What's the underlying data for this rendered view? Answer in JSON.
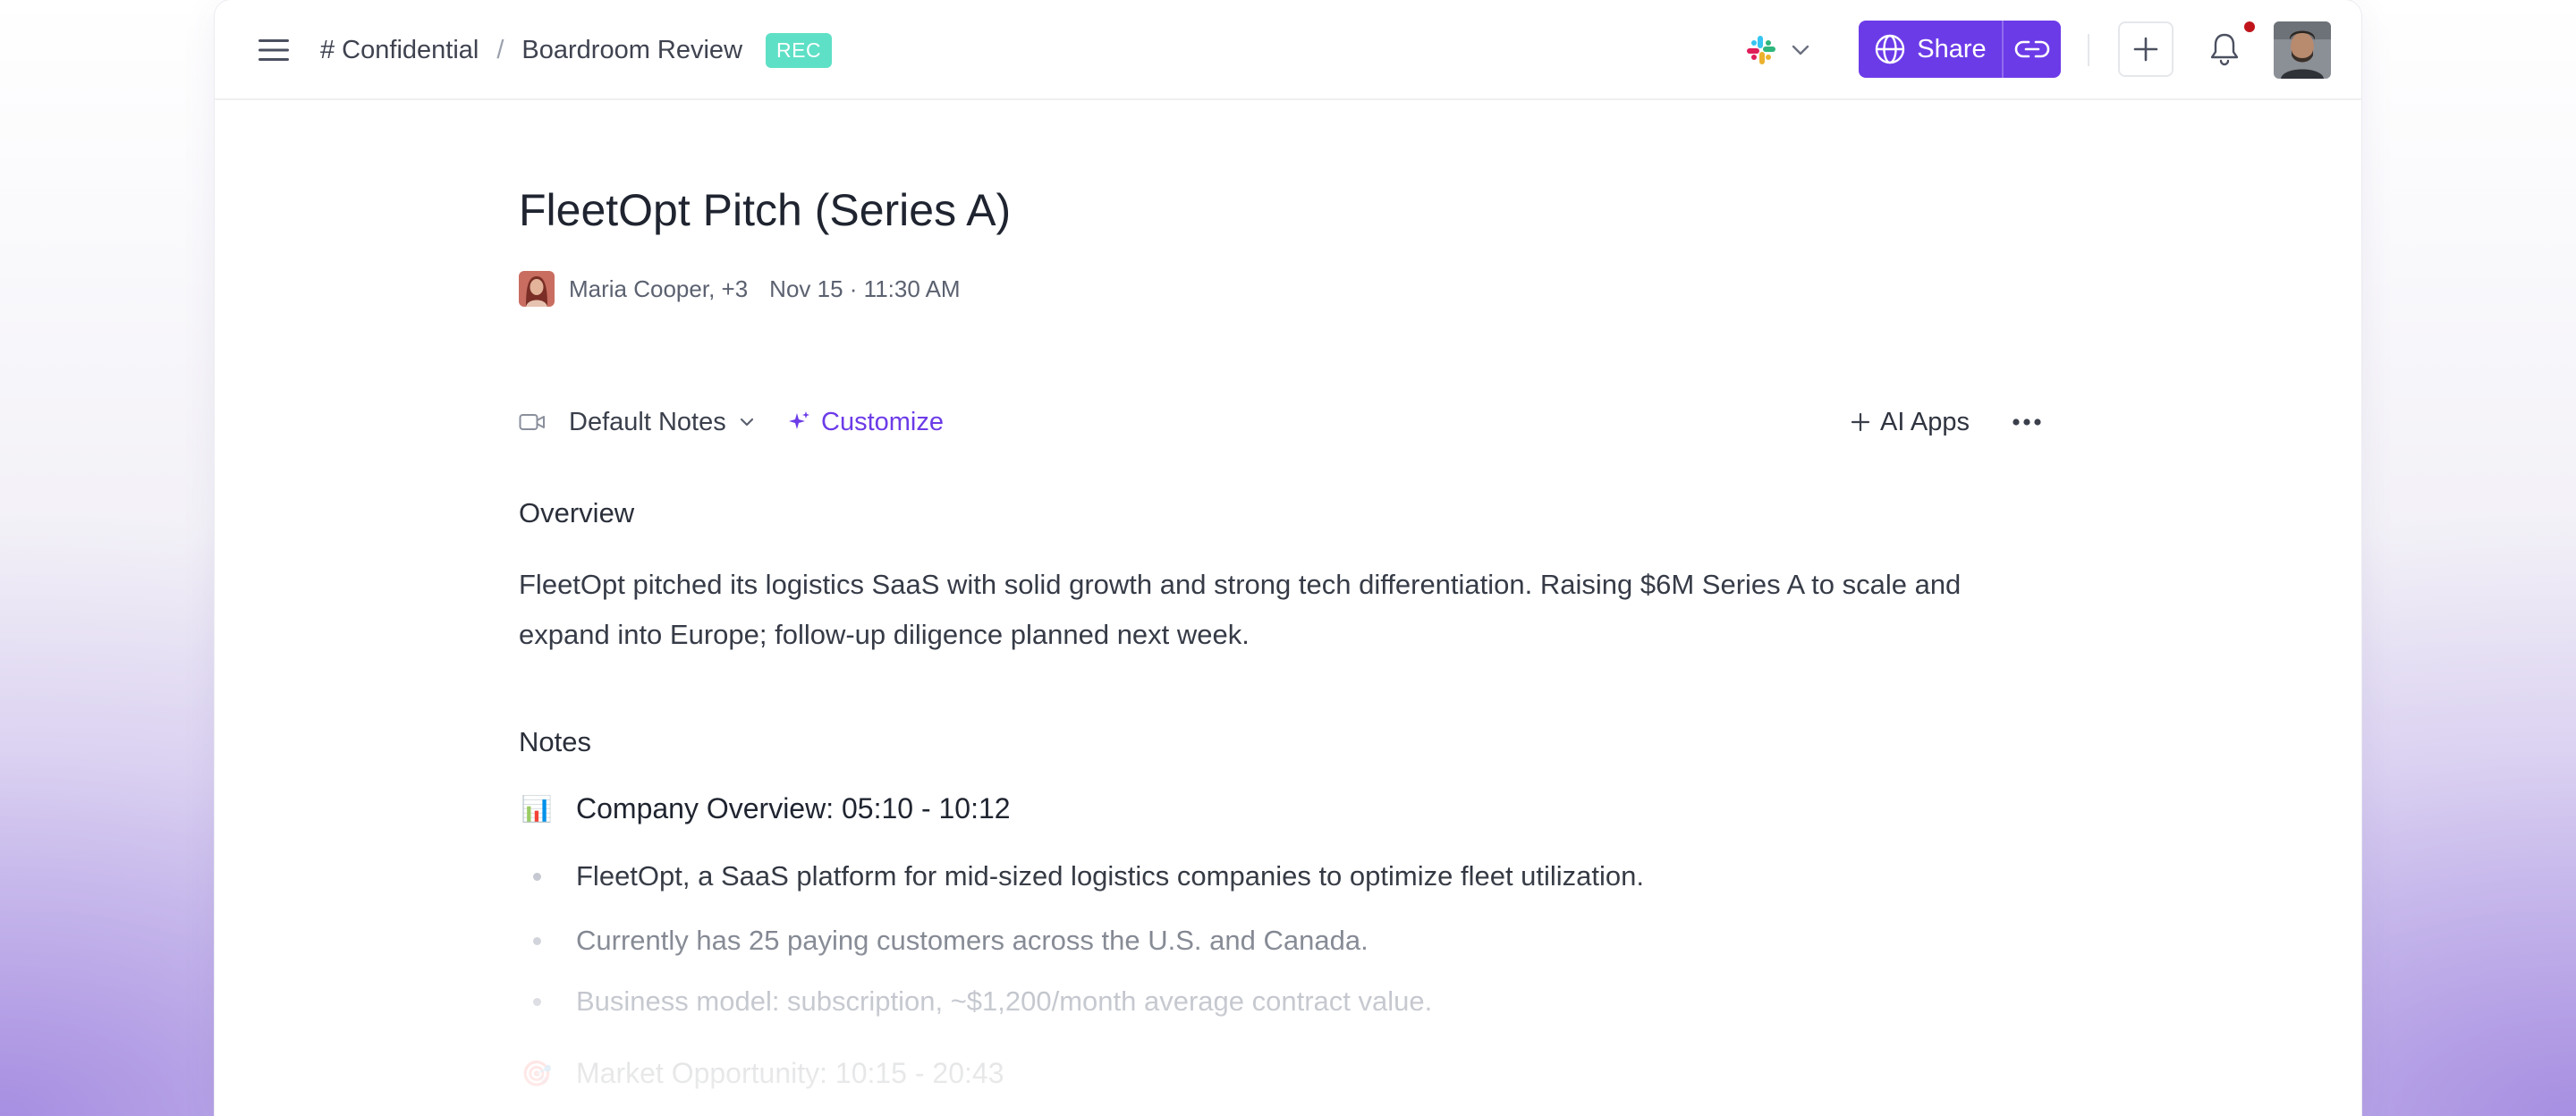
{
  "header": {
    "breadcrumb": {
      "channel": "# Confidential",
      "separator": "/",
      "page": "Boardroom Review"
    },
    "rec_badge": "REC",
    "share_label": "Share",
    "icons": [
      "menu-icon",
      "slack-icon",
      "chevron-down-icon",
      "globe-icon",
      "link-icon",
      "plus-icon",
      "bell-icon"
    ]
  },
  "meeting": {
    "title": "FleetOpt Pitch (Series A)",
    "participants": "Maria Cooper, +3",
    "datetime": "Nov 15 · 11:30 AM"
  },
  "toolbar": {
    "template_label": "Default Notes",
    "customize_label": "Customize",
    "ai_apps_label": "AI Apps"
  },
  "overview": {
    "heading": "Overview",
    "text": "FleetOpt pitched its logistics SaaS with solid growth and strong tech differentiation. Raising $6M Series A to scale and expand into Europe; follow-up diligence planned next week."
  },
  "notes": {
    "heading": "Notes",
    "sections": [
      {
        "emoji": "📊",
        "title": "Company Overview: 05:10 - 10:12",
        "bullets": [
          "FleetOpt, a SaaS platform for mid-sized logistics companies to optimize fleet utilization.",
          "Currently has 25 paying customers across the U.S. and Canada.",
          "Business model: subscription, ~$1,200/month average contract value."
        ]
      },
      {
        "emoji": "🎯",
        "title": "Market Opportunity: 10:15 - 20:43",
        "bullets": []
      }
    ]
  },
  "colors": {
    "accent": "#6c3be8",
    "rec_badge": "#5ee0c6",
    "notification_dot": "#c0141a"
  }
}
